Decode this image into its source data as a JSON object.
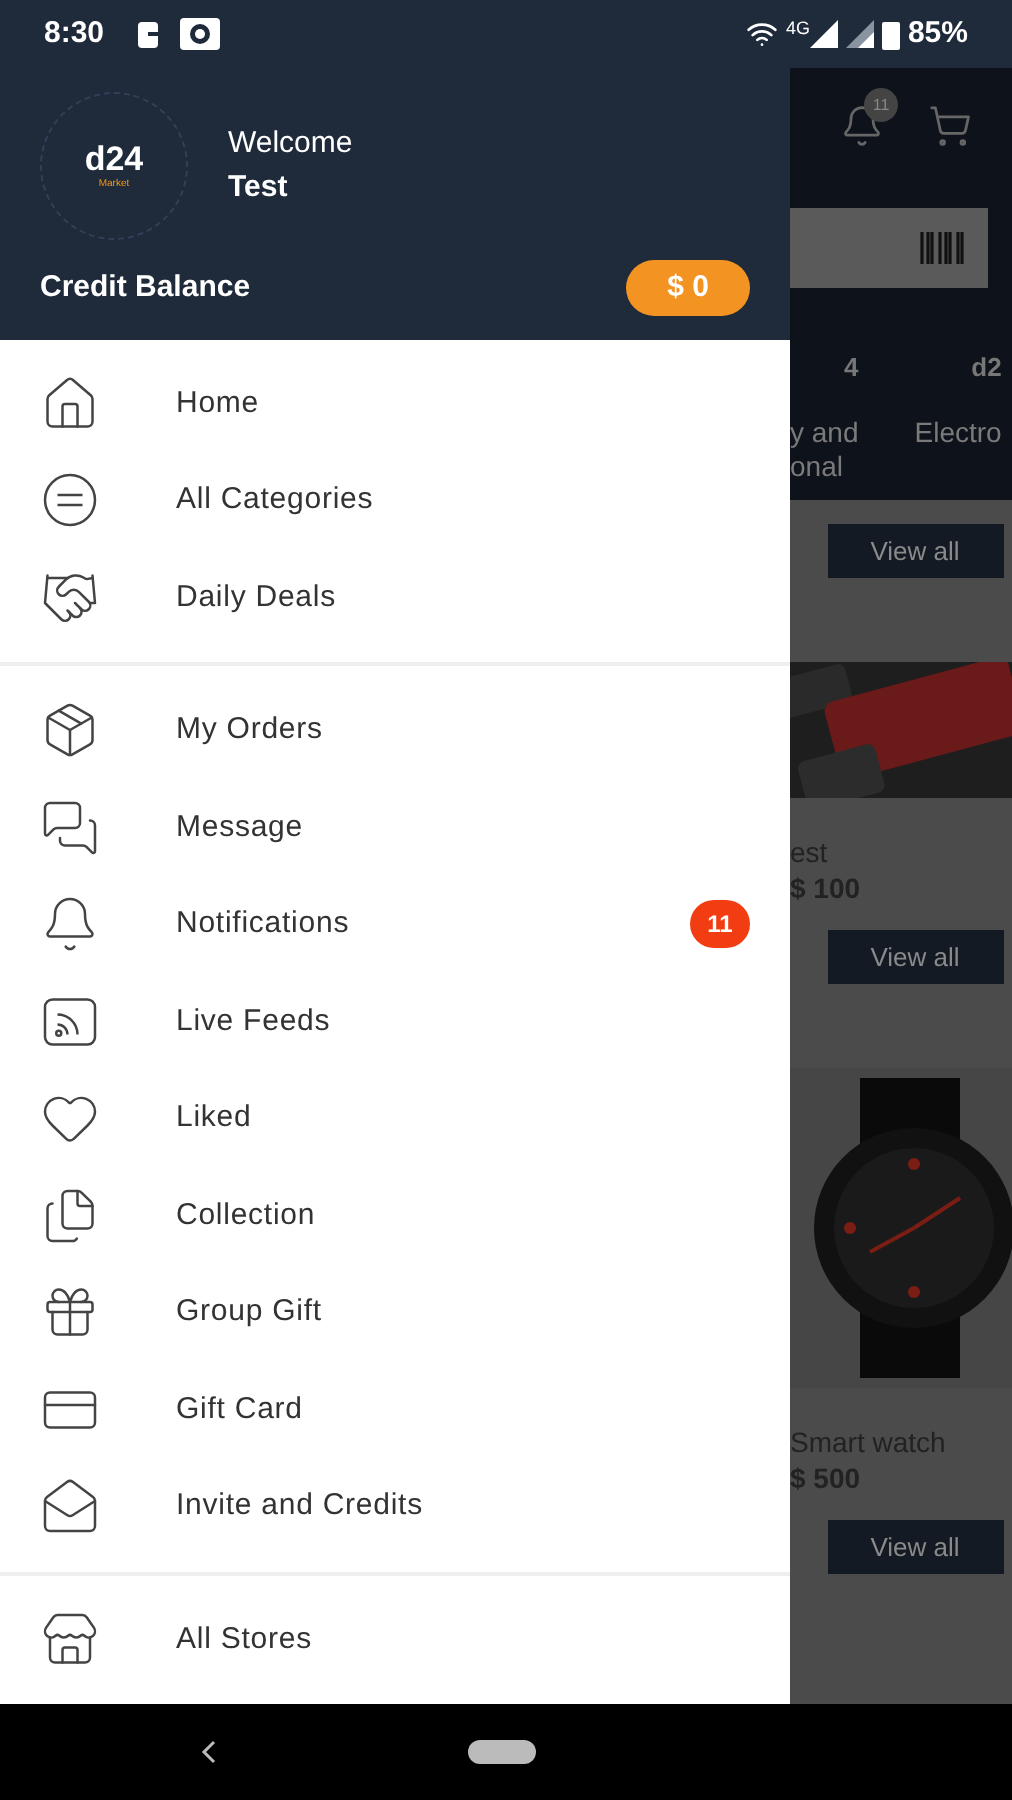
{
  "status_bar": {
    "time": "8:30",
    "network": "4G",
    "battery": "85%"
  },
  "drawer": {
    "logo": {
      "text": "d24",
      "subtext": "Market"
    },
    "greeting": "Welcome",
    "user": "Test",
    "credit_label": "Credit Balance",
    "credit_value": "$ 0",
    "groups": [
      [
        {
          "label": "Home"
        },
        {
          "label": "All Categories"
        },
        {
          "label": "Daily Deals"
        }
      ],
      [
        {
          "label": "My Orders"
        },
        {
          "label": "Message"
        },
        {
          "label": "Notifications",
          "badge": "11"
        },
        {
          "label": "Live Feeds"
        },
        {
          "label": "Liked"
        },
        {
          "label": "Collection"
        },
        {
          "label": "Group Gift"
        },
        {
          "label": "Gift Card"
        },
        {
          "label": "Invite and Credits"
        }
      ],
      [
        {
          "label": "All Stores"
        }
      ]
    ]
  },
  "background_page": {
    "notification_badge": "11",
    "categories": [
      {
        "logo": "4",
        "name_lines": [
          "y and",
          "onal"
        ]
      },
      {
        "logo": "d2",
        "name_lines": [
          "Electro"
        ]
      }
    ],
    "sections": [
      {
        "button": "View all",
        "product": {
          "name": "est",
          "price": "$ 100"
        }
      },
      {
        "button": "View all",
        "product": {
          "name": "Smart watch",
          "price": "$ 500"
        }
      },
      {
        "button": "View all"
      }
    ]
  }
}
